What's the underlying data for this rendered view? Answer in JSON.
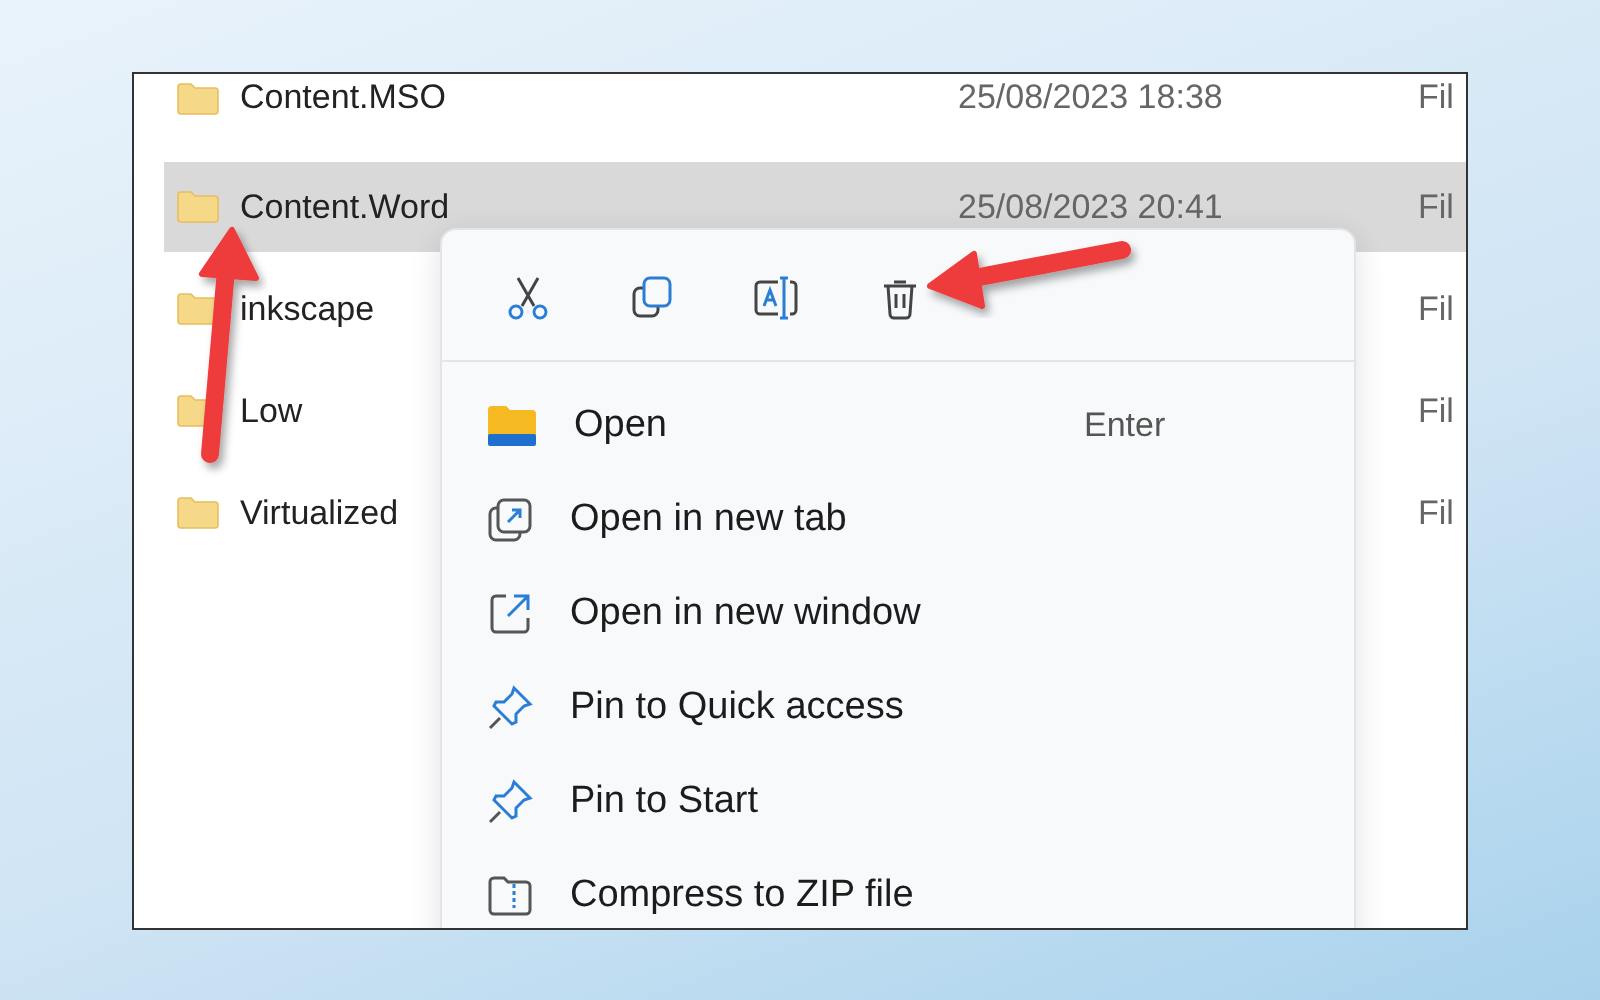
{
  "files": [
    {
      "name": "Content.MSO",
      "date": "25/08/2023 18:38",
      "type": "Fil",
      "selected": false
    },
    {
      "name": "Content.Word",
      "date": "25/08/2023 20:41",
      "type": "Fil",
      "selected": true
    },
    {
      "name": "inkscape",
      "type": "Fil",
      "selected": false
    },
    {
      "name": "Low",
      "type": "Fil",
      "selected": false
    },
    {
      "name": "Virtualized",
      "type": "Fil",
      "selected": false
    }
  ],
  "context_menu": {
    "toolbar": [
      {
        "kind": "cut"
      },
      {
        "kind": "copy"
      },
      {
        "kind": "rename"
      },
      {
        "kind": "delete"
      }
    ],
    "items": [
      {
        "kind": "open",
        "label": "Open",
        "shortcut": "Enter"
      },
      {
        "kind": "new-tab",
        "label": "Open in new tab"
      },
      {
        "kind": "new-window",
        "label": "Open in new window"
      },
      {
        "kind": "pin",
        "label": "Pin to Quick access"
      },
      {
        "kind": "pin",
        "label": "Pin to Start"
      },
      {
        "kind": "zip",
        "label": "Compress to ZIP file"
      }
    ]
  }
}
